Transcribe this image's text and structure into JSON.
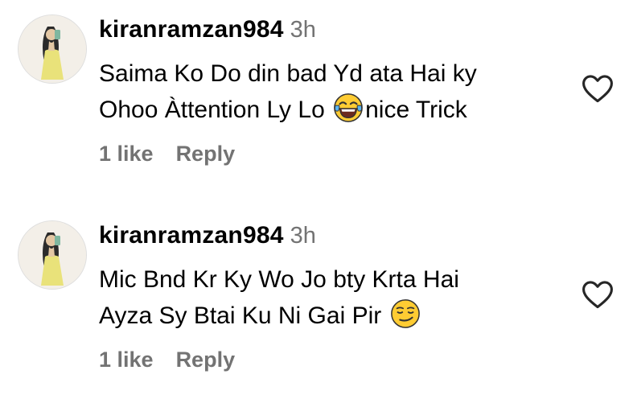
{
  "comments": [
    {
      "username": "kiranramzan984",
      "time": "3h",
      "text_lines": [
        "Saima Ko Do din bad Yd ata Hai ky",
        "Ohoo Àttention Ly Lo ",
        "nice Trick"
      ],
      "emoji": "tears-of-joy-emoji",
      "likes": "1 like",
      "reply": "Reply"
    },
    {
      "username": "kiranramzan984",
      "time": "3h",
      "text_lines": [
        "Mic Bnd Kr Ky Wo Jo bty Krta Hai",
        "Ayza Sy Btai Ku Ni Gai Pir "
      ],
      "emoji": "smirking-face-emoji",
      "likes": "1 like",
      "reply": "Reply"
    }
  ],
  "icons": {
    "like": "heart-outline-icon",
    "avatar": "profile-avatar"
  },
  "colors": {
    "secondary_text": "#737373",
    "emoji_yellow": "#ffcc33"
  }
}
